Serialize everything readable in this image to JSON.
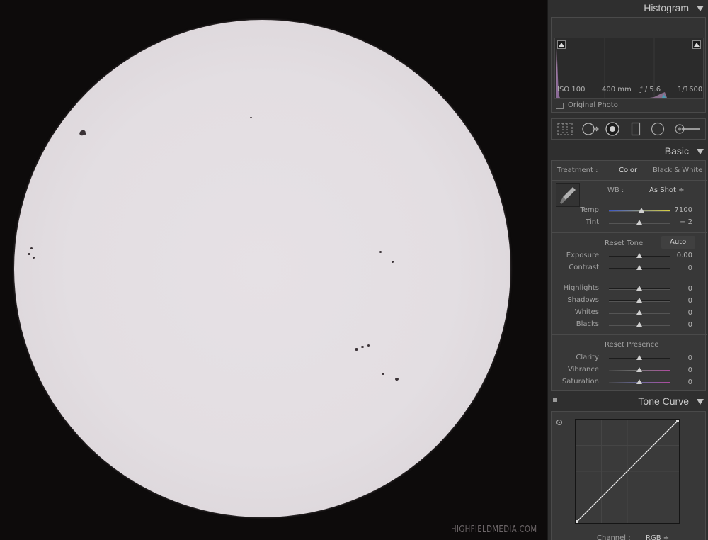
{
  "watermark": "HIGHFIELDMEDIA.COM",
  "histogram": {
    "title": "Histogram",
    "iso": "ISO 100",
    "focal": "400 mm",
    "aperture": "ƒ / 5.6",
    "shutter": "1/1600",
    "original_photo": "Original Photo"
  },
  "basic": {
    "title": "Basic",
    "treatment_label": "Treatment :",
    "treatment_color": "Color",
    "treatment_bw": "Black & White",
    "wb_label": "WB :",
    "wb_value": "As Shot ÷",
    "reset_tone": "Reset Tone",
    "auto": "Auto",
    "reset_presence": "Reset Presence",
    "sliders": {
      "temp": {
        "label": "Temp",
        "value": "7100",
        "level": 0.53
      },
      "tint": {
        "label": "Tint",
        "value": "− 2",
        "level": 0.5
      },
      "exposure": {
        "label": "Exposure",
        "value": "0.00",
        "level": 0.5
      },
      "contrast": {
        "label": "Contrast",
        "value": "0",
        "level": 0.5
      },
      "highlights": {
        "label": "Highlights",
        "value": "0",
        "level": 0.5
      },
      "shadows": {
        "label": "Shadows",
        "value": "0",
        "level": 0.5
      },
      "whites": {
        "label": "Whites",
        "value": "0",
        "level": 0.5
      },
      "blacks": {
        "label": "Blacks",
        "value": "0",
        "level": 0.5
      },
      "clarity": {
        "label": "Clarity",
        "value": "0",
        "level": 0.5
      },
      "vibrance": {
        "label": "Vibrance",
        "value": "0",
        "level": 0.5
      },
      "saturation": {
        "label": "Saturation",
        "value": "0",
        "level": 0.5
      }
    }
  },
  "tone_curve": {
    "title": "Tone Curve",
    "channel_label": "Channel :",
    "channel_value": "RGB ÷"
  },
  "colors": {
    "panel_bg": "#2f2f2f",
    "sun_disc": "#e3dee2",
    "temp_gradient": [
      "#3a55c8",
      "#d8d040"
    ],
    "tint_gradient": [
      "#40b040",
      "#c040c0"
    ]
  }
}
